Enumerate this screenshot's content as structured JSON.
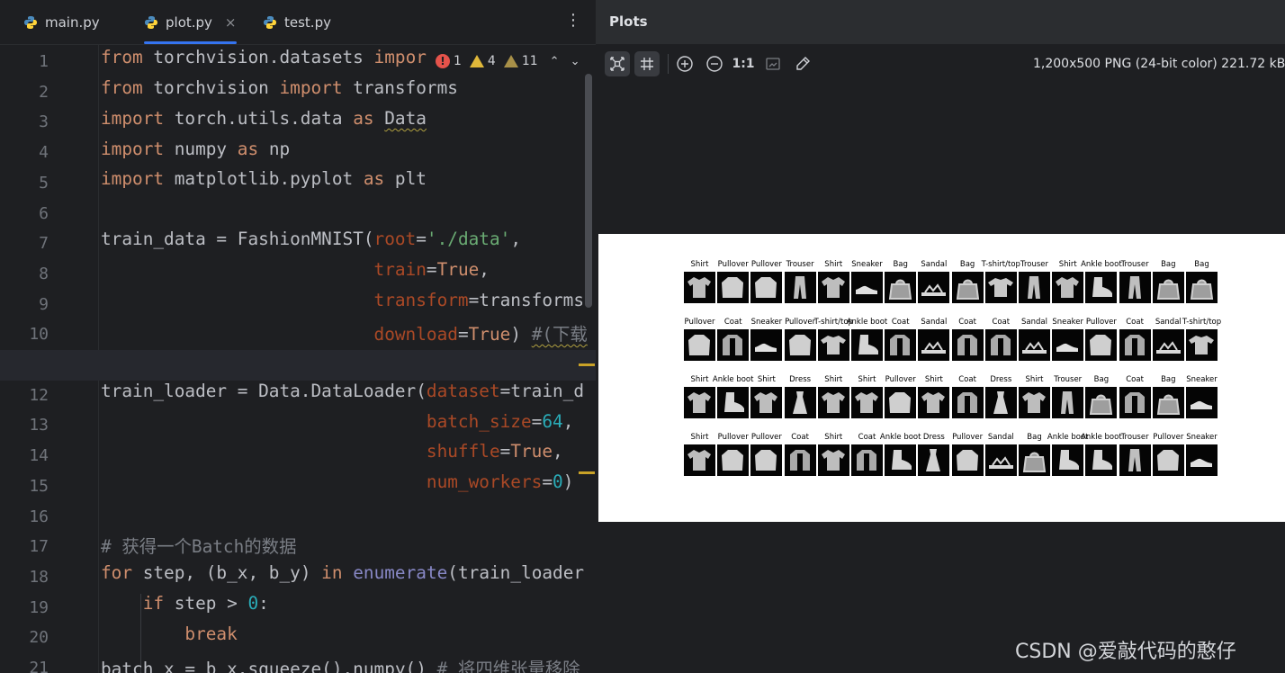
{
  "editor": {
    "tabs": [
      {
        "label": "main.py",
        "active": false
      },
      {
        "label": "plot.py",
        "active": true
      },
      {
        "label": "test.py",
        "active": false
      }
    ],
    "tab_close_glyph": "×",
    "menu_glyph": "⋮",
    "current_line": 11,
    "inspections": {
      "errors": "1",
      "warnings": "4",
      "weak_warnings": "11"
    },
    "line_numbers": [
      "1",
      "2",
      "3",
      "4",
      "5",
      "6",
      "7",
      "8",
      "9",
      "10",
      "11",
      "12",
      "13",
      "14",
      "15",
      "16",
      "17",
      "18",
      "19",
      "20",
      "21"
    ]
  },
  "plots": {
    "title": "Plots",
    "toolbar": {
      "zoom_actual_label": "1:1",
      "buttons": [
        "fit-icon",
        "grid-icon",
        "zoom-in-icon",
        "zoom-out-icon",
        "actual-size",
        "background-icon",
        "color-picker-icon"
      ]
    },
    "image_info": "1,200x500 PNG (24-bit color) 221.72 kB",
    "grid_labels": [
      [
        "Shirt",
        "Pullover",
        "Pullover",
        "Trouser",
        "Shirt",
        "Sneaker",
        "Bag",
        "Sandal",
        "Bag",
        "T-shirt/top",
        "Trouser",
        "Shirt",
        "Ankle boot",
        "Trouser",
        "Bag",
        "Bag"
      ],
      [
        "Pullover",
        "Coat",
        "Sneaker",
        "Pullover",
        "T-shirt/top",
        "Ankle boot",
        "Coat",
        "Sandal",
        "Coat",
        "Coat",
        "Sandal",
        "Sneaker",
        "Pullover",
        "Coat",
        "Sandal",
        "T-shirt/top"
      ],
      [
        "Shirt",
        "Ankle boot",
        "Shirt",
        "Dress",
        "Shirt",
        "Shirt",
        "Pullover",
        "Shirt",
        "Coat",
        "Dress",
        "Shirt",
        "Trouser",
        "Bag",
        "Coat",
        "Bag",
        "Sneaker"
      ],
      [
        "Shirt",
        "Pullover",
        "Pullover",
        "Coat",
        "Shirt",
        "Coat",
        "Ankle boot",
        "Dress",
        "Pullover",
        "Sandal",
        "Bag",
        "Ankle boot",
        "Ankle boot",
        "Trouser",
        "Pullover",
        "Sneaker"
      ]
    ]
  },
  "watermark": "CSDN @爱敲代码的憨仔"
}
